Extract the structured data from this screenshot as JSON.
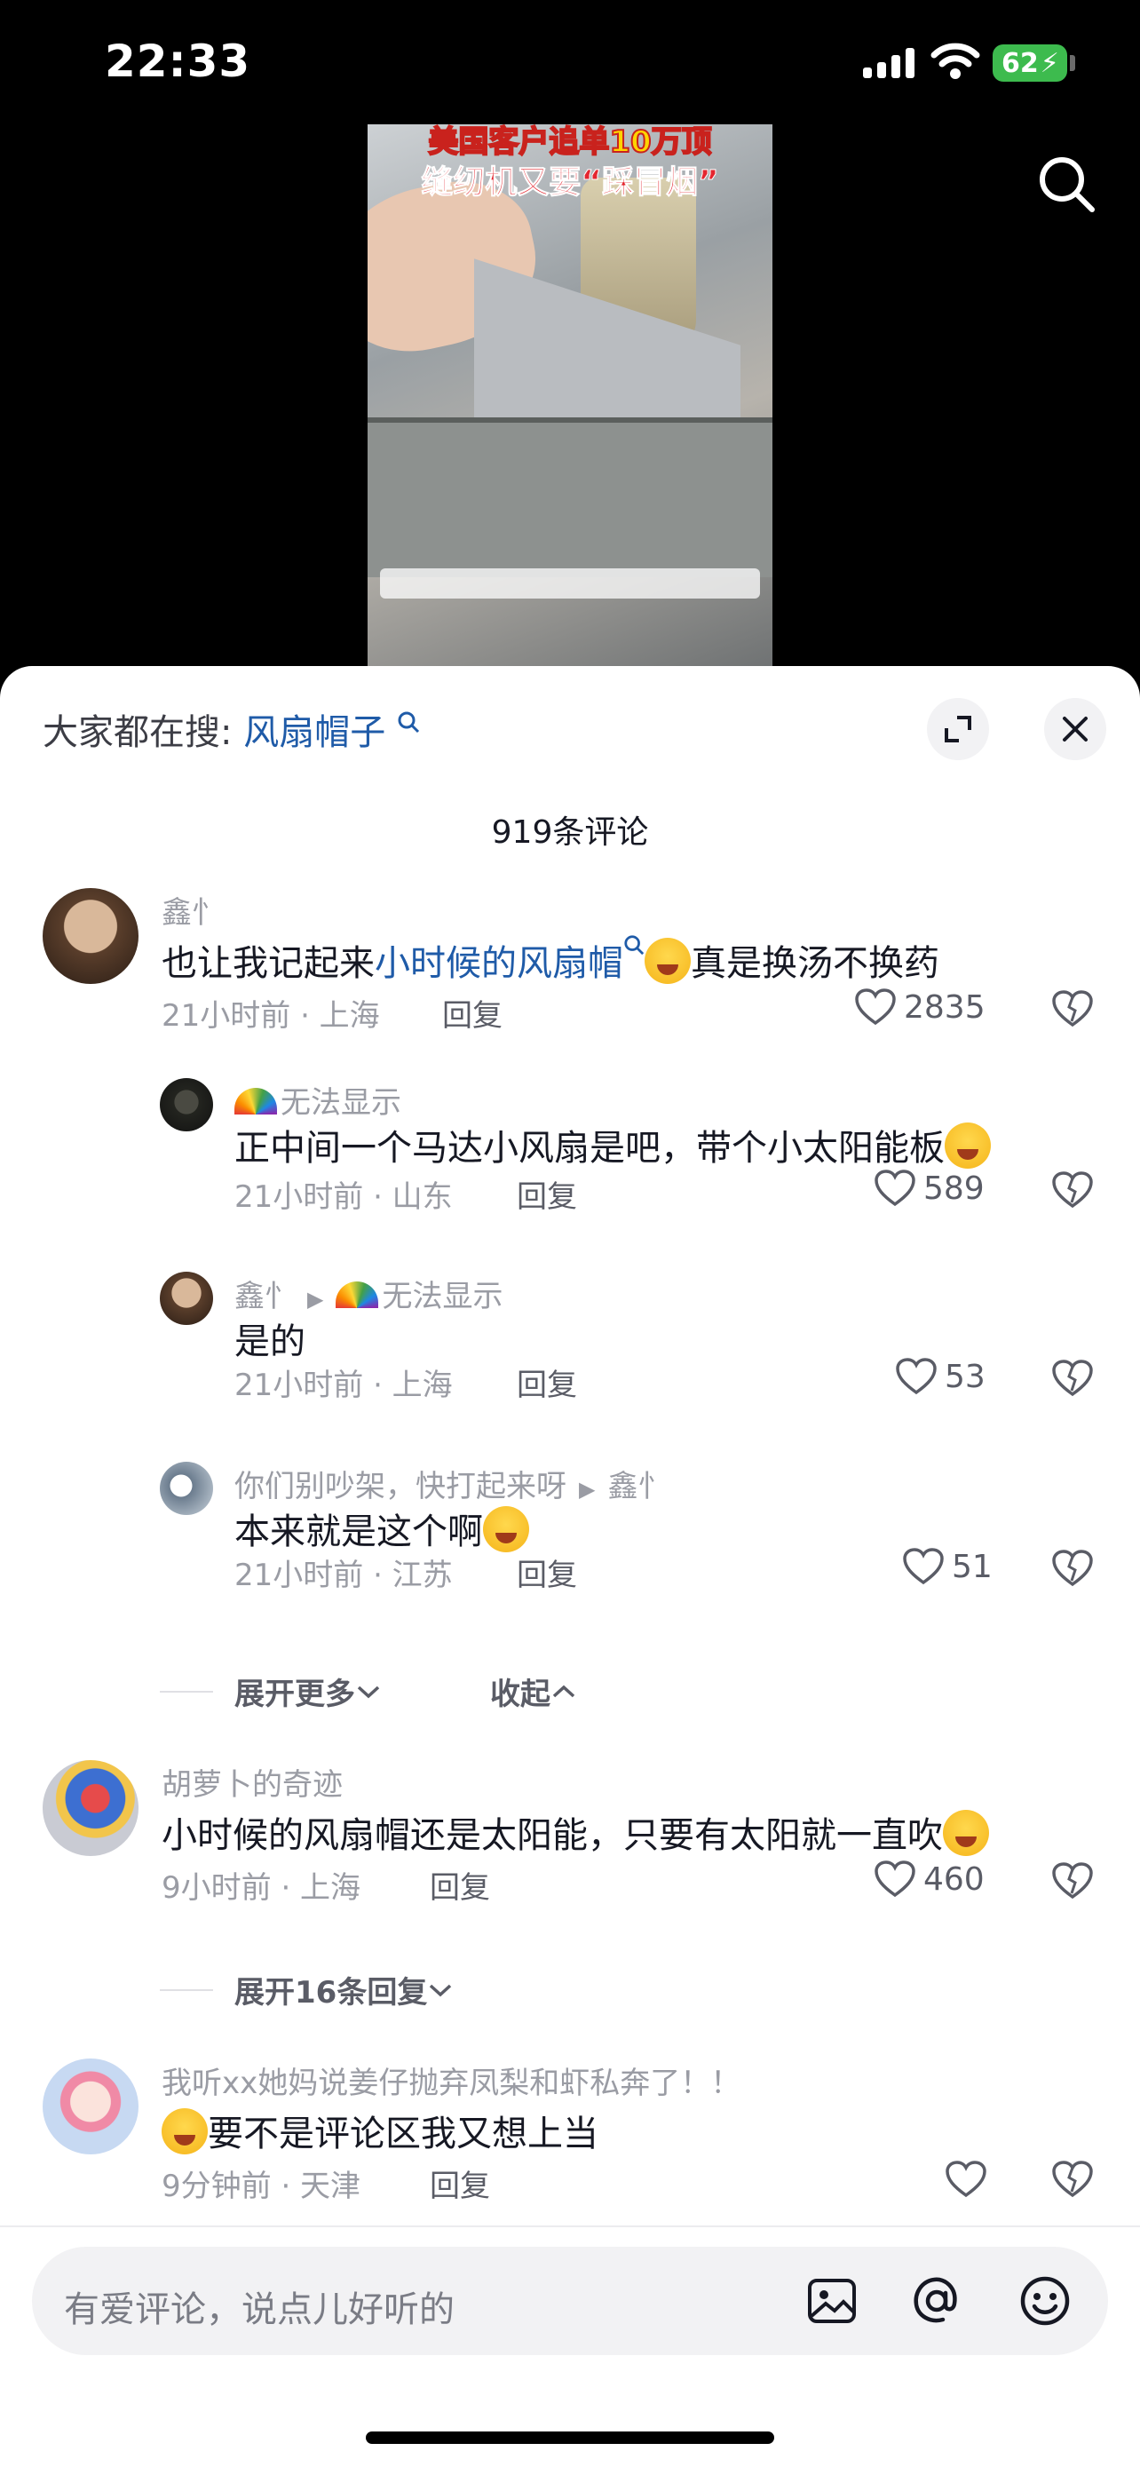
{
  "status": {
    "time": "22:33",
    "battery": "62"
  },
  "video": {
    "caption_line1": "美国客户追单10万顶",
    "caption_line2": "缝纫机又要“踩冒烟”"
  },
  "sheet": {
    "trend_prefix": "大家都在搜:",
    "trend_keyword": "风扇帽子",
    "comment_count": "919条评论"
  },
  "comments": [
    {
      "name": "鑫忄",
      "text_a": "也让我记起来",
      "text_link": "小时候的风扇帽",
      "text_b": "真是换汤不换药",
      "meta": "21小时前 · 上海",
      "reply": "回复",
      "likes": "2835"
    },
    {
      "name": "无法显示",
      "text": "正中间一个马达小风扇是吧，带个小太阳能板",
      "meta": "21小时前 · 山东",
      "reply": "回复",
      "likes": "589"
    },
    {
      "name": "鑫忄",
      "reply_to": "无法显示",
      "text": "是的",
      "meta": "21小时前 · 上海",
      "reply": "回复",
      "likes": "53"
    },
    {
      "name": "你们别吵架，快打起来呀",
      "reply_to": "鑫忄",
      "text": "本来就是这个啊",
      "meta": "21小时前 · 江苏",
      "reply": "回复",
      "likes": "51"
    },
    {
      "name": "胡萝卜的奇迹",
      "text": "小时候的风扇帽还是太阳能，只要有太阳就一直吹",
      "meta": "9小时前 · 上海",
      "reply": "回复",
      "likes": "460"
    },
    {
      "name": "我听xx她妈说姜仔抛弃凤梨和虾私奔了！！",
      "text": "要不是评论区我又想上当",
      "meta": "9分钟前 · 天津",
      "reply": "回复"
    }
  ],
  "expand": {
    "more": "展开更多",
    "collapse": "收起",
    "replies16": "展开16条回复"
  },
  "input": {
    "placeholder": "有爱评论，说点儿好听的"
  }
}
